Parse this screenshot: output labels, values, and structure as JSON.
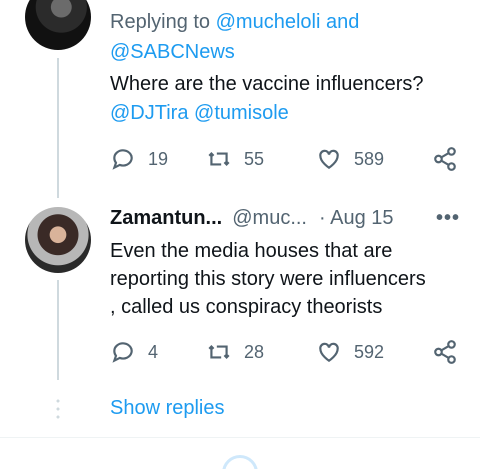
{
  "tweet1": {
    "replying_prefix": "Replying to",
    "reply_handle_1": "@mucheloli",
    "reply_and": "and",
    "reply_handle_2": "@SABCNews",
    "text": "Where are the vaccine influencers?",
    "mention_1": "@DJTira",
    "mention_2": "@tumisole",
    "replies": "19",
    "retweets": "55",
    "likes": "589"
  },
  "tweet2": {
    "display_name": "Zamantun...",
    "handle": "@muc...",
    "date": "· Aug 15",
    "more": "•••",
    "text_line_1": "Even the media houses that are",
    "text_line_2": "reporting this story were influencers",
    "text_line_3": ", called us conspiracy theorists",
    "replies": "4",
    "retweets": "28",
    "likes": "592"
  },
  "show_replies_label": "Show replies",
  "icons": [
    "reply-icon",
    "retweet-icon",
    "like-icon",
    "share-icon",
    "more-icon"
  ],
  "colors": {
    "link": "#1d9bf0",
    "text": "#0f1419",
    "secondary": "#536471",
    "thread_line": "#cfd9de"
  }
}
